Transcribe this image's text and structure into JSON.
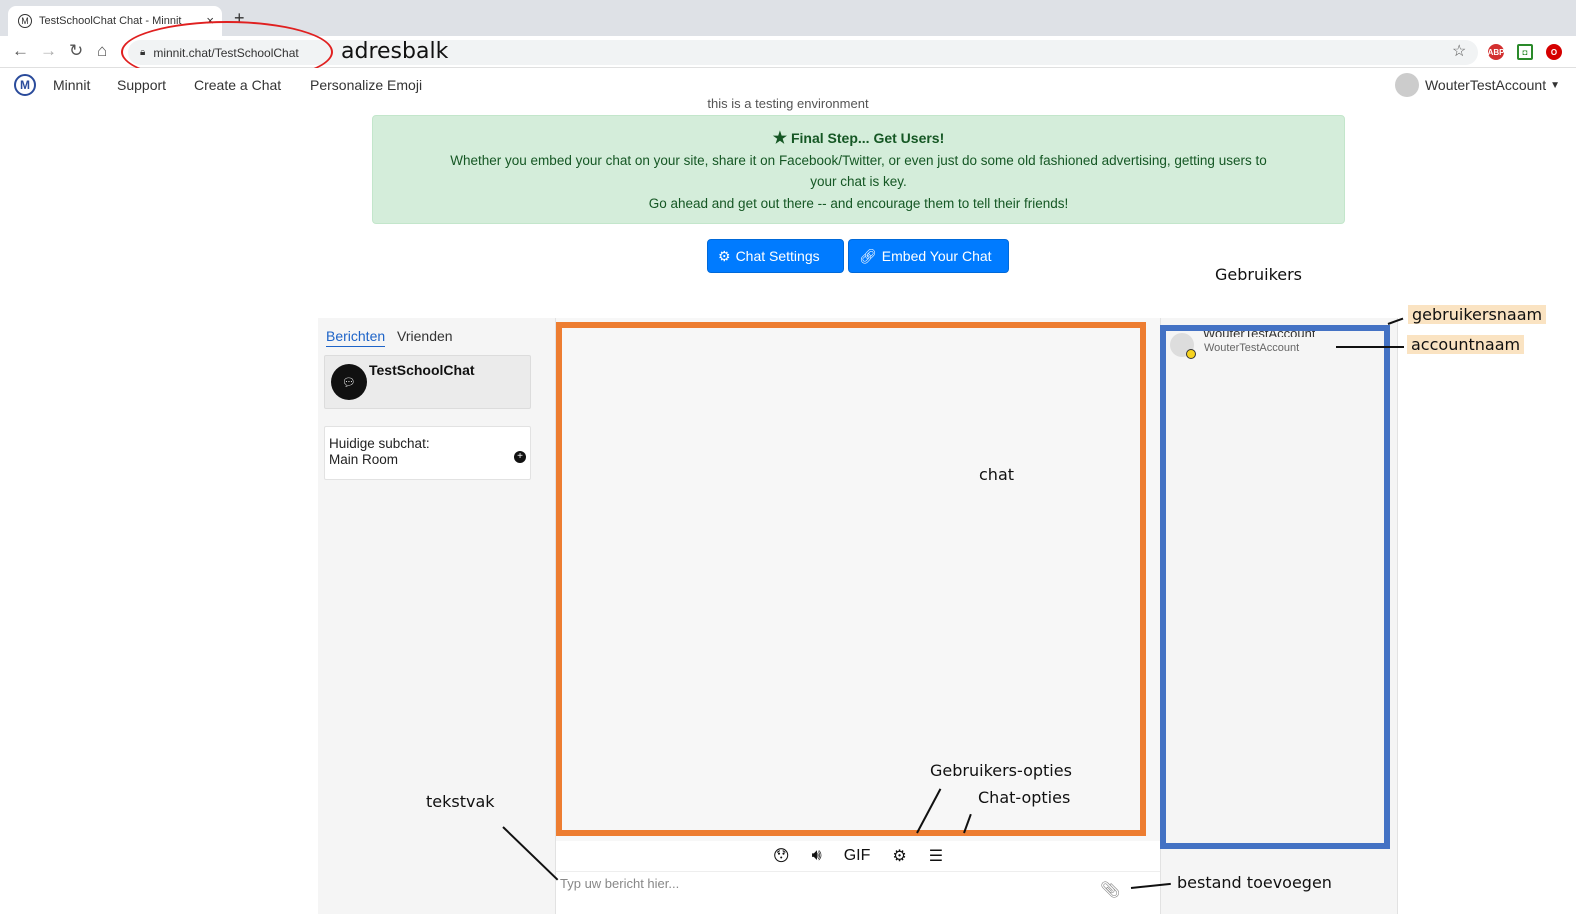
{
  "browser": {
    "tab_title": "TestSchoolChat Chat - Minnit",
    "favicon_letter": "M",
    "tab_close": "×",
    "new_tab": "+",
    "url": "minnit.chat/TestSchoolChat",
    "extensions": [
      "ABP",
      "◘",
      "O"
    ]
  },
  "navbar": {
    "logo_letter": "M",
    "links": [
      "Minnit",
      "Support",
      "Create a Chat",
      "Personalize Emoji"
    ],
    "account": "WouterTestAccount"
  },
  "env_notice": "this is a testing environment",
  "alert": {
    "title": "Final Step... Get Users!",
    "line1": "Whether you embed your chat on your site, share it on Facebook/Twitter, or even just do some old fashioned advertising, getting users to",
    "line2": "your chat is key.",
    "line3": "Go ahead and get out there -- and encourage them to tell their friends!"
  },
  "buttons": {
    "settings": "Chat Settings",
    "embed": "Embed Your Chat"
  },
  "left_panel": {
    "tab_messages": "Berichten",
    "tab_friends": "Vrienden",
    "chat_name": "TestSchoolChat",
    "subchat_label": "Huidige subchat:",
    "subchat_name": "Main Room"
  },
  "chat_toolbar": {
    "gif": "GIF"
  },
  "input": {
    "placeholder": "Typ uw bericht hier..."
  },
  "users": {
    "username": "WouterTestAccount",
    "accountname": "WouterTestAccount"
  },
  "annotations": {
    "adresbalk": "adresbalk",
    "gebruikers": "Gebruikers",
    "gebruikersnaam": "gebruikersnaam",
    "accountnaam": "accountnaam",
    "chat": "chat",
    "gebruikers_opties": "Gebruikers-opties",
    "chat_opties": "Chat-opties",
    "tekstvak": "tekstvak",
    "bestand_toevoegen": "bestand toevoegen"
  },
  "colors": {
    "chat_frame": "#ed7d31",
    "users_frame": "#4472c4",
    "primary_button": "#007bff",
    "alert_bg": "#d4edda"
  }
}
